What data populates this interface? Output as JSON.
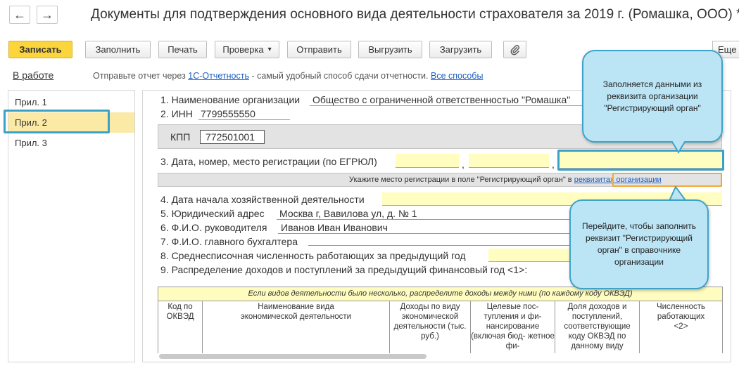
{
  "window": {
    "title": "Документы для подтверждения основного вида деятельности страхователя за 2019 г. (Ромашка, ООО) *",
    "back_icon": "←",
    "forward_icon": "→"
  },
  "toolbar": {
    "save": "Записать",
    "fill": "Заполнить",
    "print": "Печать",
    "check": "Проверка",
    "dropdown_arrow": "▾",
    "send": "Отправить",
    "upload": "Выгрузить",
    "load": "Загрузить",
    "attach_icon": "📎",
    "more": "Еще"
  },
  "info": {
    "status": "В работе",
    "hint_prefix": "Отправьте отчет через ",
    "hint_link": "1С-Отчетность",
    "hint_middle": " - самый удобный способ сдачи отчетности. ",
    "hint_all": "Все способы"
  },
  "sidebar": {
    "items": [
      {
        "label": "Прил. 1"
      },
      {
        "label": "Прил. 2"
      },
      {
        "label": "Прил. 3"
      }
    ]
  },
  "form": {
    "l1": "1. Наименование организации",
    "org_name": "Общество с ограниченной ответственностью \"Ромашка\"",
    "l2": "2. ИНН",
    "inn": "7799555550",
    "kpp_label": "КПП",
    "kpp": "772501001",
    "l3": "3. Дата, номер, место регистрации (по ЕГРЮЛ)",
    "comma1": ",",
    "comma2": ",",
    "reg_hint": "Укажите место регистрации в поле \"Регистрирующий орган\" в ",
    "reg_hint_link": "реквизитах организации",
    "l4": "4. Дата начала хозяйственной деятельности",
    "l5": "5. Юридический адрес",
    "address": "Москва г, Вавилова ул, д. № 1",
    "l6": "6. Ф.И.О. руководителя",
    "director": "Иванов Иван Иванович",
    "l7": "7. Ф.И.О. главного бухгалтера",
    "l8": "8. Среднесписочная численность работающих за предыдущий год",
    "l9": "9. Распределение доходов и поступлений за предыдущий финансовый год <1>:"
  },
  "table": {
    "note": "Если видов деятельности было несколько, распределите доходы между ними (по каждому коду ОКВЭД)",
    "columns": [
      "Код по ОКВЭД",
      "Наименование вида экономической деятельности",
      "Доходы по виду экономической деятельности (тыс. руб.)",
      "Целевые пос- тупления и фи- нансирование (включая бюд- жетное фи-",
      "Доля доходов и поступлений, соответствующие коду ОКВЭД по данному виду",
      "Численность работающих <2>"
    ]
  },
  "callouts": {
    "top": "Заполняется данными из реквизита организации \"Регистрирующий орган\"",
    "bottom": "Перейдите, чтобы заполнить реквизит \"Регистрирующий орган\" в справочнике организации"
  },
  "colors": {
    "accent_yellow": "#fbd53b",
    "field_yellow": "#fffdbf",
    "highlight_blue": "#3ba1c6",
    "callout_fill": "#bbe4f5",
    "link": "#1a5ec2"
  }
}
